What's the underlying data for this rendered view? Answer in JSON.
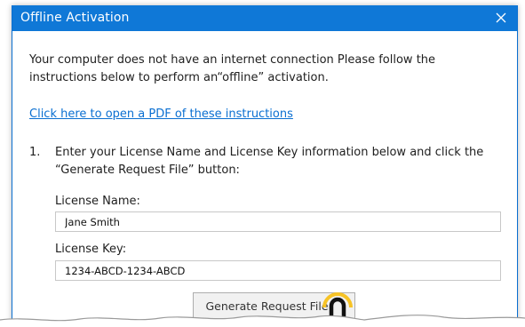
{
  "window": {
    "title": "Offline Activation",
    "close_icon": "close-icon"
  },
  "dialog": {
    "intro_text": "Your computer does not have an internet connection Please follow the instructions below to perform an“offline” activation.",
    "pdf_link": "Click here to open a PDF of these instructions",
    "step": {
      "number": "1.",
      "text": "Enter your License Name and License Key information below and click the “Generate Request File” button:"
    },
    "license_name": {
      "label": "License Name:",
      "value": "Jane Smith"
    },
    "license_key": {
      "label": "License Key:",
      "value": "1234-ABCD-1234-ABCD"
    },
    "generate_button": "Generate Request File"
  },
  "colors": {
    "titlebar": "#0f78d7",
    "link": "#0a6fd1",
    "highlight": "#f7c326"
  }
}
